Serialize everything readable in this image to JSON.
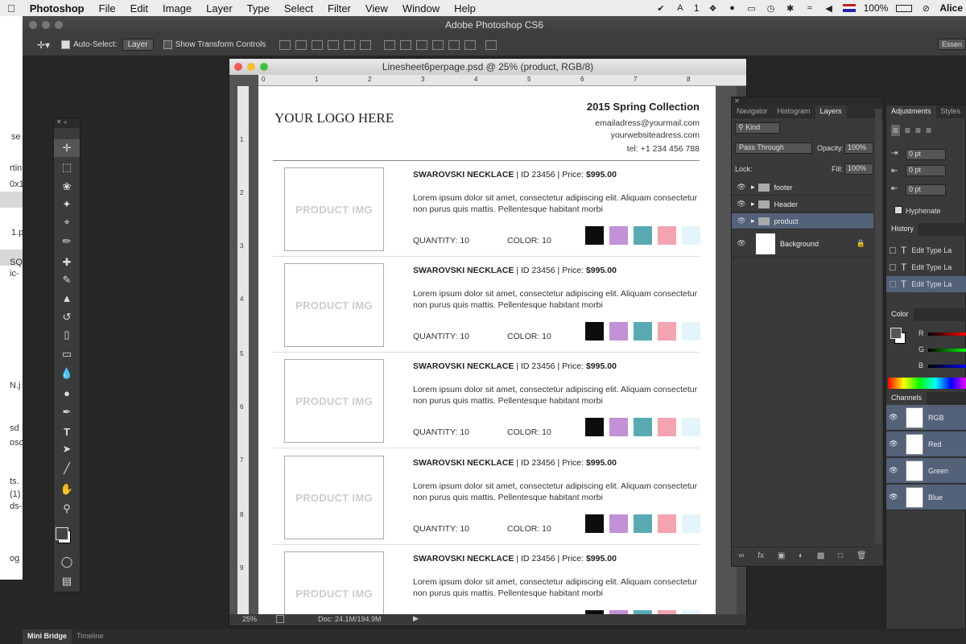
{
  "menubar": {
    "app": "Photoshop",
    "items": [
      "File",
      "Edit",
      "Image",
      "Layer",
      "Type",
      "Select",
      "Filter",
      "View",
      "Window",
      "Help"
    ],
    "status": {
      "battery": "100%",
      "user": "Alice",
      "badge": "1"
    }
  },
  "background_app_fragments": [
    "se",
    "rtin",
    "0x1",
    "1.p",
    "SQ",
    "ic-",
    "N.j",
    "sd",
    "osc",
    "ts.",
    "(1)",
    "ds-",
    "og"
  ],
  "window": {
    "title": "Adobe Photoshop CS6"
  },
  "options_bar": {
    "auto_select_label": "Auto-Select:",
    "auto_select_value": "Layer",
    "transform_label": "Show Transform Controls",
    "workspace": "Essen"
  },
  "toolbox": {
    "tools": [
      "move-tool-icon",
      "marquee-tool-icon",
      "lasso-tool-icon",
      "magic-wand-icon",
      "crop-tool-icon",
      "eyedropper-icon",
      "healing-brush-icon",
      "brush-tool-icon",
      "clone-stamp-icon",
      "history-brush-icon",
      "eraser-icon",
      "gradient-tool-icon",
      "blur-tool-icon",
      "dodge-tool-icon",
      "pen-tool-icon",
      "type-tool-icon",
      "path-selection-icon",
      "line-tool-icon",
      "hand-tool-icon",
      "zoom-tool-icon"
    ]
  },
  "document": {
    "title": "Linesheet6perpage.psd @ 25% (product, RGB/8)",
    "zoom": "25%",
    "doc_size": "Doc: 24.1M/194.9M",
    "hruler": [
      "0",
      "1",
      "2",
      "3",
      "4",
      "5",
      "6",
      "7",
      "8"
    ],
    "vruler": [
      "1",
      "2",
      "3",
      "4",
      "5",
      "6",
      "7",
      "8",
      "9"
    ]
  },
  "linesheet": {
    "logo": "YOUR LOGO HERE",
    "collection": "2015 Spring Collection",
    "email": "emailadress@yourmail.com",
    "website": "yourwebsiteadress.com",
    "tel": "tel: +1 234 456 788",
    "products": [
      {
        "img": "PRODUCT IMG",
        "name": "SWAROVSKI NECKLACE",
        "id": "| ID 23456",
        "price_label": "| Price:",
        "price": "$995.00",
        "desc": "Lorem ipsum dolor sit amet, consectetur adipiscing elit. Aliquam consectetur non purus quis mattis. Pellentesque habitant morbi",
        "qty": "QUANTITY:  10",
        "color": "COLOR:  10"
      },
      {
        "img": "PRODUCT IMG",
        "name": "SWAROVSKI NECKLACE",
        "id": "| ID 23456",
        "price_label": "| Price:",
        "price": "$995.00",
        "desc": "Lorem ipsum dolor sit amet, consectetur adipiscing elit. Aliquam consectetur non purus quis mattis. Pellentesque habitant morbi",
        "qty": "QUANTITY:  10",
        "color": "COLOR:  10"
      },
      {
        "img": "PRODUCT IMG",
        "name": "SWAROVSKI NECKLACE",
        "id": "| ID 23456",
        "price_label": "| Price:",
        "price": "$995.00",
        "desc": "Lorem ipsum dolor sit amet, consectetur adipiscing elit. Aliquam consectetur non purus quis mattis. Pellentesque habitant morbi",
        "qty": "QUANTITY:  10",
        "color": "COLOR:  10"
      },
      {
        "img": "PRODUCT IMG",
        "name": "SWAROVSKI NECKLACE",
        "id": "| ID 23456",
        "price_label": "| Price:",
        "price": "$995.00",
        "desc": "Lorem ipsum dolor sit amet, consectetur adipiscing elit. Aliquam consectetur non purus quis mattis. Pellentesque habitant morbi",
        "qty": "QUANTITY:  10",
        "color": "COLOR:  10"
      },
      {
        "img": "PRODUCT IMG",
        "name": "SWAROVSKI NECKLACE",
        "id": "| ID 23456",
        "price_label": "| Price:",
        "price": "$995.00",
        "desc": "Lorem ipsum dolor sit amet, consectetur adipiscing elit. Aliquam consectetur non purus quis mattis. Pellentesque habitant morbi",
        "qty": "",
        "color": ""
      }
    ],
    "swatch_colors": [
      "#0d0d0d",
      "#c291d6",
      "#5aaab4",
      "#f4a3b0",
      "#e4f4fb"
    ]
  },
  "layers_panel": {
    "tabs": [
      "Navigator",
      "Histogram",
      "Layers"
    ],
    "kind": "Kind",
    "blend": "Pass Through",
    "opacity_label": "Opacity:",
    "opacity": "100%",
    "lock_label": "Lock:",
    "fill_label": "Fill:",
    "fill": "100%",
    "layers": [
      {
        "name": "footer",
        "type": "folder"
      },
      {
        "name": "Header",
        "type": "folder"
      },
      {
        "name": "product",
        "type": "folder",
        "selected": true
      },
      {
        "name": "Background",
        "type": "image"
      }
    ],
    "footer_icons": [
      "link-icon",
      "fx-icon",
      "mask-icon",
      "adjustment-icon",
      "folder-icon",
      "new-layer-icon",
      "trash-icon"
    ]
  },
  "adjustments_panel": {
    "tabs": [
      "Adjustments",
      "Styles"
    ],
    "fields": [
      "0 pt",
      "0 pt",
      "0 pt"
    ],
    "hyphenate": "Hyphenate"
  },
  "history_panel": {
    "title": "History",
    "items": [
      "Edit Type La",
      "Edit Type La",
      "Edit Type La"
    ]
  },
  "color_panel": {
    "title": "Color",
    "channels": [
      "R",
      "G",
      "B"
    ]
  },
  "channels_panel": {
    "title": "Channels",
    "items": [
      "RGB",
      "Red",
      "Green",
      "Blue"
    ]
  },
  "bottom_tabs": [
    "Mini Bridge",
    "Timeline"
  ]
}
